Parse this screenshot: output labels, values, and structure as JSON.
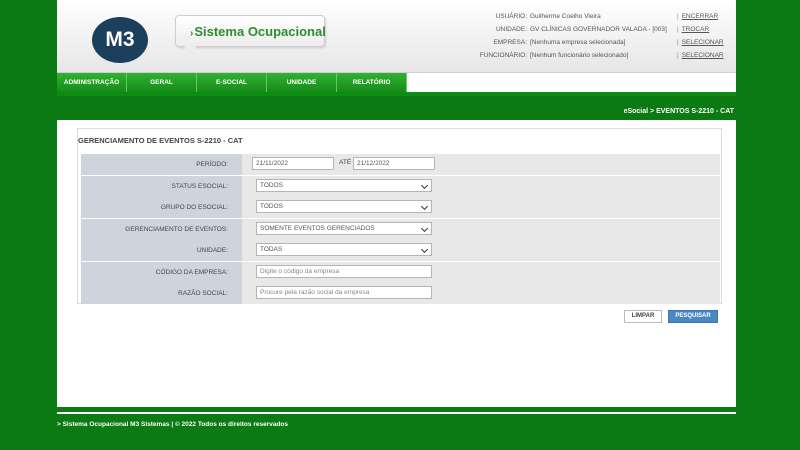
{
  "header": {
    "logo_text": "M3",
    "app_title": "Sistema Ocupacional",
    "info": [
      {
        "key": "USUÁRIO:",
        "value": "Guilherme Coelho Vieira",
        "action": "ENCERRAR"
      },
      {
        "key": "UNIDADE:",
        "value": "GV CLÍNICAS GOVERNADOR VALADA - [003]",
        "action": "TROCAR"
      },
      {
        "key": "EMPRESA:",
        "value": "[Nenhuma empresa selecionada]",
        "action": "SELECIONAR"
      },
      {
        "key": "FUNCIONÁRIO:",
        "value": "[Nenhum funcionário selecionado]",
        "action": "SELECIONAR"
      }
    ]
  },
  "nav": [
    "ADMINISTRAÇÃO",
    "GERAL",
    "E-SOCIAL",
    "UNIDADE",
    "RELATÓRIO"
  ],
  "breadcrumb": "eSocial > EVENTOS S-2210 - CAT",
  "panel": {
    "title": "GERENCIAMENTO DE EVENTOS S-2210 - CAT",
    "periodo_label": "PERÍODO:",
    "periodo_inicio": "21/11/2022",
    "ate_label": "ATÉ",
    "periodo_fim": "21/12/2022",
    "status_label": "STATUS ESOCIAL:",
    "status_value": "TODOS",
    "grupo_label": "GRUPO DO ESOCIAL:",
    "grupo_value": "TODOS",
    "gerenciamento_label": "GERENCIAMENTO DE EVENTOS:",
    "gerenciamento_value": "SOMENTE EVENTOS GERENCIADOS",
    "unidade_label": "UNIDADE:",
    "unidade_value": "TODAS",
    "codigo_label": "CÓDIGO DA EMPRESA:",
    "codigo_placeholder": "Digite o código da empresa",
    "razao_label": "RAZÃO SOCIAL:",
    "razao_placeholder": "Procure pela razão social da empresa"
  },
  "buttons": {
    "clear": "LIMPAR",
    "search": "PESQUISAR"
  },
  "footer": "> Sistema Ocupacional M3 Sistemas | © 2022 Todos os direitos reservados"
}
